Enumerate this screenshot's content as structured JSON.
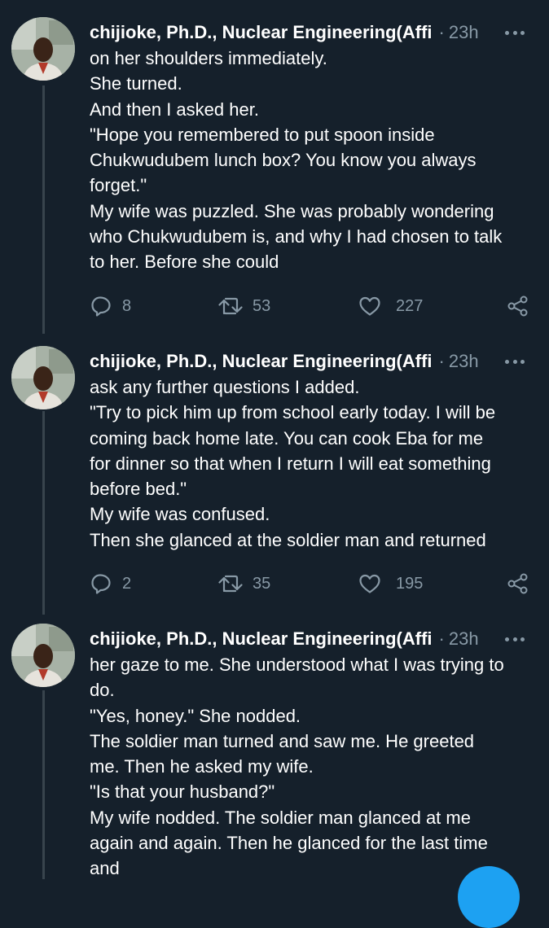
{
  "colors": {
    "background": "#15202b",
    "text_primary": "#ffffff",
    "text_secondary": "#8899a6",
    "thread_line": "#38444d",
    "accent": "#1da1f2"
  },
  "tweets": [
    {
      "author": "chijioke, Ph.D., Nuclear Engineering(Affi",
      "separator": "·",
      "time": "23h",
      "lines": [
        "on her shoulders immediately.",
        "She turned.",
        "And then I asked her.",
        "\"Hope you remembered to put spoon inside",
        "Chukwudubem lunch box? You know you always",
        "forget.\"",
        "My wife was puzzled. She was probably wondering",
        "who Chukwudubem is, and why I had chosen to talk",
        "to her. Before she could"
      ],
      "replies": "8",
      "retweets": "53",
      "likes": "227"
    },
    {
      "author": "chijioke, Ph.D., Nuclear Engineering(Affi",
      "separator": "·",
      "time": "23h",
      "lines": [
        "ask any further questions I added.",
        "\"Try to pick him up from school early today. I will be",
        "coming back home late. You can cook Eba for me",
        "for dinner so that when I return I will eat something",
        "before bed.\"",
        "My wife was confused.",
        "Then she glanced at the soldier man and returned"
      ],
      "replies": "2",
      "retweets": "35",
      "likes": "195"
    },
    {
      "author": "chijioke, Ph.D., Nuclear Engineering(Affi",
      "separator": "·",
      "time": "23h",
      "lines": [
        "her gaze to me. She understood what I was trying to",
        "do.",
        "\"Yes, honey.\" She nodded.",
        "The soldier man turned and saw me. He greeted",
        "me. Then he asked my wife.",
        "\"Is that your husband?\"",
        "My wife nodded. The soldier man glanced at me",
        "again and again. Then he glanced for the last time",
        "and"
      ]
    }
  ],
  "icons": {
    "reply": "reply-icon",
    "retweet": "retweet-icon",
    "like": "heart-icon",
    "share": "share-icon",
    "more": "more-options-icon"
  }
}
